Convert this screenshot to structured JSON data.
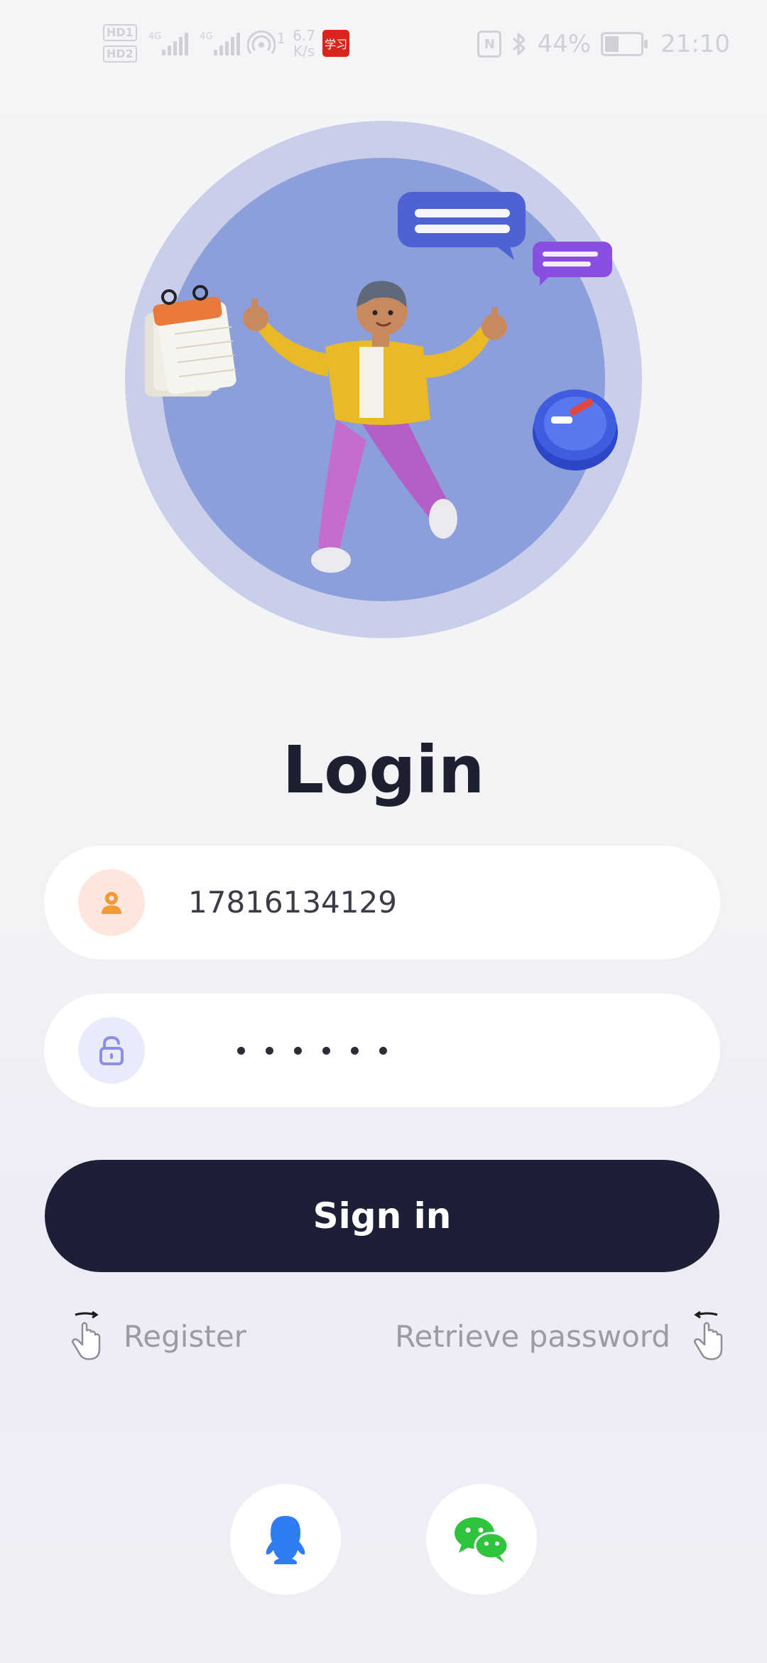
{
  "status_bar": {
    "hd1": "HD1",
    "hd2": "HD2",
    "net1": "4G",
    "net2": "4G",
    "hotspot_count": "1",
    "speed_value": "6.7",
    "speed_unit": "K/s",
    "app_badge": "学习",
    "nfc": "N",
    "bluetooth_icon": "bluetooth-icon",
    "battery_percent": "44%",
    "battery_level": 0.44,
    "time": "21:10"
  },
  "login": {
    "title": "Login",
    "username_value": "17816134129",
    "password_mask_count": 6,
    "sign_in_label": "Sign in"
  },
  "links": {
    "register": "Register",
    "retrieve_password": "Retrieve password"
  },
  "social": {
    "qq_icon": "qq-icon",
    "wechat_icon": "wechat-icon"
  },
  "colors": {
    "button_bg": "#1d1f36",
    "user_icon_accent": "#f29a3a",
    "lock_icon_accent": "#8c90e0",
    "qq_blue": "#2f7cf5",
    "wechat_green": "#2fc43c"
  }
}
